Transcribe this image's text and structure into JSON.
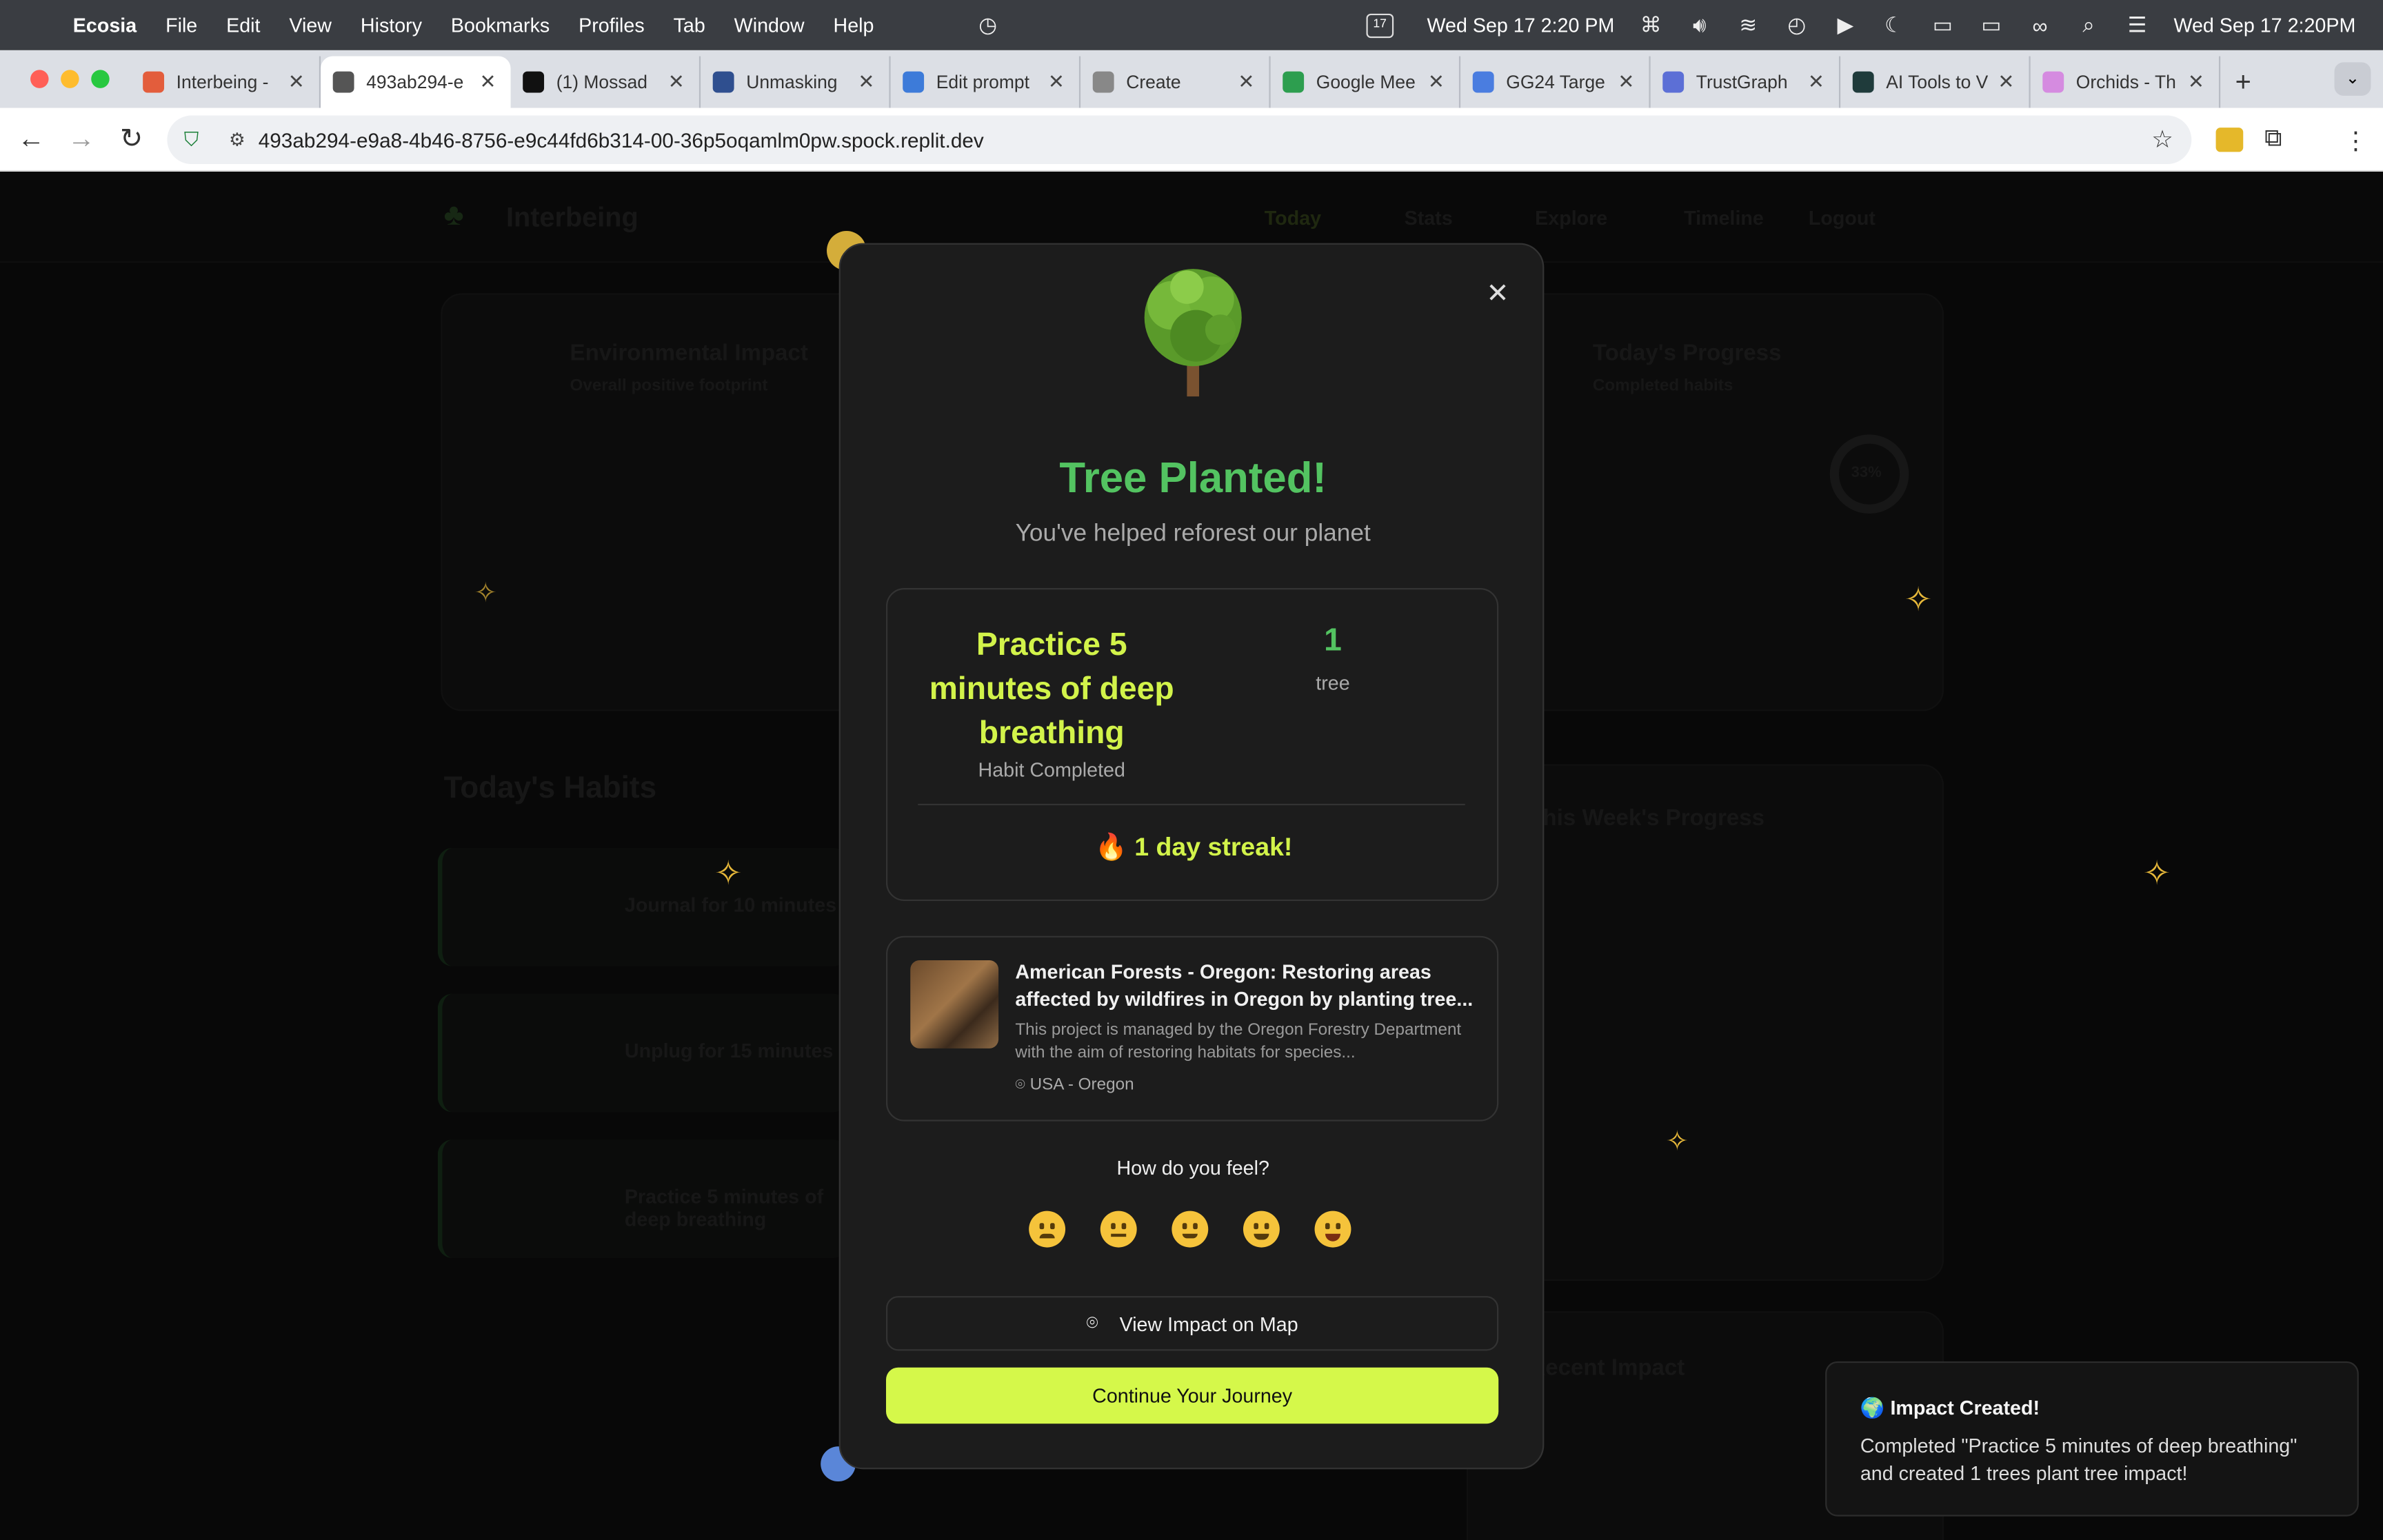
{
  "menubar": {
    "app": "Ecosia",
    "items": [
      "File",
      "Edit",
      "View",
      "History",
      "Bookmarks",
      "Profiles",
      "Tab",
      "Window",
      "Help"
    ],
    "date_label": "17",
    "clock_left": "Wed Sep 17  2:20 PM",
    "clock_right": "Wed Sep 17  2:20PM"
  },
  "tabs": [
    {
      "title": "Interbeing -",
      "fav_color": "#e35d3c"
    },
    {
      "title": "493ab294-e",
      "fav_color": "#555555"
    },
    {
      "title": "(1) Mossad",
      "fav_color": "#111111"
    },
    {
      "title": "Unmasking",
      "fav_color": "#2f4f8f"
    },
    {
      "title": "Edit prompt",
      "fav_color": "#3d7bd9"
    },
    {
      "title": "Create",
      "fav_color": "#888888"
    },
    {
      "title": "Google Mee",
      "fav_color": "#2d9e4f"
    },
    {
      "title": "GG24 Targe",
      "fav_color": "#4a7de0"
    },
    {
      "title": "TrustGraph",
      "fav_color": "#5c6fd6"
    },
    {
      "title": "AI Tools to V",
      "fav_color": "#1f3b3b"
    },
    {
      "title": "Orchids - Th",
      "fav_color": "#d58be0"
    }
  ],
  "address": {
    "url": "493ab294-e9a8-4b46-8756-e9c44fd6b314-00-36p5oqamlm0pw.spock.replit.dev"
  },
  "background": {
    "brand": "Interbeing",
    "nav": [
      "Today",
      "Stats",
      "Explore",
      "Timeline",
      "Logout"
    ],
    "impact_title": "Environmental Impact",
    "impact_sub": "Overall positive footprint",
    "progress_title": "Today's Progress",
    "progress_sub": "Completed habits",
    "progress_pct": "33%",
    "habits_title": "Today's Habits",
    "habits": [
      "Journal for 10 minutes",
      "Unplug for 15 minutes",
      "Practice 5 minutes of deep breathing"
    ],
    "week_title": "This Week's Progress",
    "impact2_title": "Recent Impact"
  },
  "modal": {
    "title": "Tree Planted!",
    "subtitle": "You've helped reforest our planet",
    "habit_name": "Practice 5 minutes of deep breathing",
    "habit_caption": "Habit Completed",
    "tree_count": "1",
    "tree_label": "tree",
    "streak": "🔥 1 day streak!",
    "project_title": "American Forests - Oregon: Restoring areas affected by wildfires in Oregon by planting tree...",
    "project_desc": "This project is managed by the Oregon Forestry Department with the aim of restoring habitats for species...",
    "project_location": "USA - Oregon",
    "feel_prompt": "How do you feel?",
    "moods": [
      "very-sad",
      "neutral",
      "slightly-happy",
      "happy",
      "star-struck"
    ],
    "map_button": "View Impact on Map",
    "continue_button": "Continue Your Journey"
  },
  "toast": {
    "title": "🌍 Impact Created!",
    "body": "Completed \"Practice 5 minutes of deep breathing\" and created 1 trees plant tree impact!"
  },
  "colors": {
    "green": "#53c361",
    "lime": "#d2f34a",
    "button": "#d5f84a"
  }
}
